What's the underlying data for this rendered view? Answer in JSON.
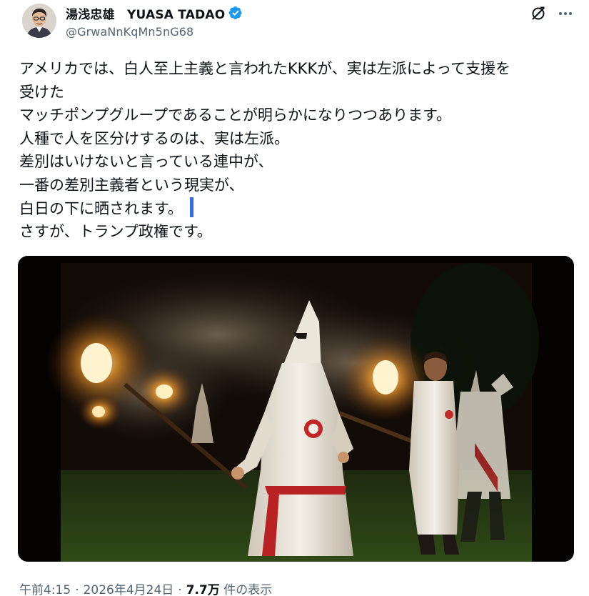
{
  "post": {
    "author": {
      "display_name": "湯浅忠雄　YUASA TADAO",
      "handle": "@GrwaNnKqMn5nG68",
      "verified": true,
      "verified_color": "#1d9bf0"
    },
    "icons": {
      "grok": "grok-icon",
      "more": "more-options-icon",
      "verified": "verified-badge-icon"
    },
    "text_lines": [
      "アメリカでは、白人至上主義と言われたKKKが、実は左派によって支援を",
      "受けた",
      "マッチポンプグループであることが明らかになりつつあります。",
      "人種で人を区分けするのは、実は左派。",
      "差別はいけないと言っている連中が、",
      "一番の差別主義者という現実が、",
      "白日の下に晒されます。",
      "さすが、トランプ政権です。"
    ],
    "meta": {
      "time": "午前4:15",
      "date": "2026年4月24日",
      "views": "7.7万",
      "views_label": "件の表示"
    },
    "colors": {
      "text": "#0f1419",
      "secondary": "#536471",
      "caret": "#3b6fd6"
    }
  }
}
